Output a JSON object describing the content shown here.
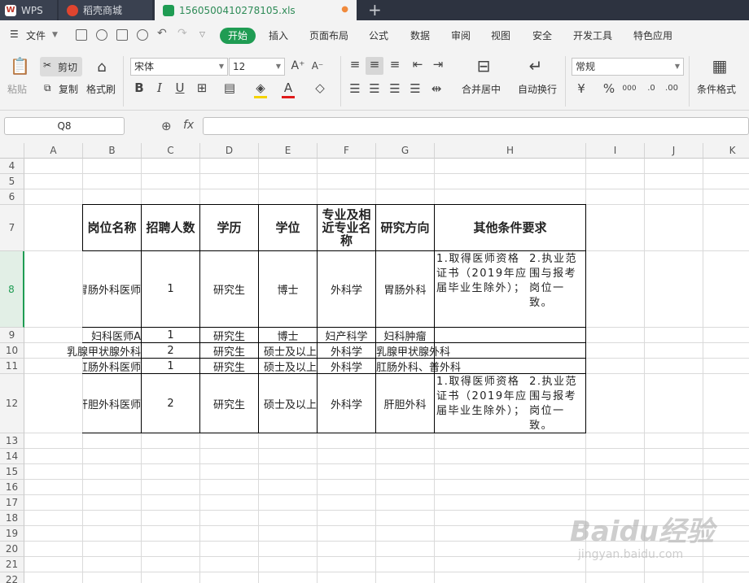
{
  "titlebar": {
    "app_tab": "WPS",
    "shop_tab": "稻壳商城",
    "file_tab": "1560500410278105.xls",
    "plus": "+"
  },
  "menubar": {
    "file": "文件",
    "items": [
      "开始",
      "插入",
      "页面布局",
      "公式",
      "数据",
      "审阅",
      "视图",
      "安全",
      "开发工具",
      "特色应用"
    ]
  },
  "ribbon": {
    "paste": "粘贴",
    "cut": "剪切",
    "copy": "复制",
    "format_painter": "格式刷",
    "font_name": "宋体",
    "font_size": "12",
    "bold": "B",
    "italic": "I",
    "underline": "U",
    "merge_center": "合并居中",
    "wrap_text": "自动换行",
    "number_format": "常规",
    "percent": "%",
    "thousands": "000",
    "cond_format": "条件格式"
  },
  "formula_bar": {
    "name_box": "Q8",
    "fx": "fx"
  },
  "columns": [
    "A",
    "B",
    "C",
    "D",
    "E",
    "F",
    "G",
    "H",
    "I",
    "J",
    "K"
  ],
  "rows": [
    "4",
    "5",
    "6",
    "7",
    "8",
    "9",
    "10",
    "11",
    "12",
    "13",
    "14",
    "15",
    "16",
    "17",
    "18",
    "19",
    "20",
    "21",
    "22"
  ],
  "table": {
    "headers": [
      "岗位名称",
      "招聘人数",
      "学历",
      "学位",
      "专业及相近专业名称",
      "研究方向",
      "其他条件要求"
    ],
    "rows": [
      {
        "a": "",
        "b": "胃肠外科医师",
        "c": "1",
        "d": "研究生",
        "e": "博士",
        "f": "外科学",
        "g": "胃肠外科",
        "h": "1.取得医师资格证书（2019年应届毕业生除外）；\n2.执业范围与报考岗位一致。"
      },
      {
        "a": "",
        "b": "妇科医师A",
        "c": "1",
        "d": "研究生",
        "e": "博士",
        "f": "妇产科学",
        "g": "妇科肿瘤",
        "h": ""
      },
      {
        "a": "乳腺甲状腺外科",
        "b": "",
        "c": "2",
        "d": "研究生",
        "e": "硕士及以上",
        "f": "外科学",
        "g": "乳腺甲状腺外科",
        "h": ""
      },
      {
        "a": "",
        "b": "肛肠外科医师",
        "c": "1",
        "d": "研究生",
        "e": "硕士及以上",
        "f": "外科学",
        "g": "肛肠外科、普外科",
        "h": ""
      },
      {
        "a": "",
        "b": "肝胆外科医师",
        "c": "2",
        "d": "研究生",
        "e": "硕士及以上",
        "f": "外科学",
        "g": "肝胆外科",
        "h": "1.取得医师资格证书（2019年应届毕业生除外）；\n2.执业范围与报考岗位一致。"
      }
    ]
  },
  "watermark": {
    "text": "Baidu经验",
    "url": "jingyan.baidu.com"
  }
}
